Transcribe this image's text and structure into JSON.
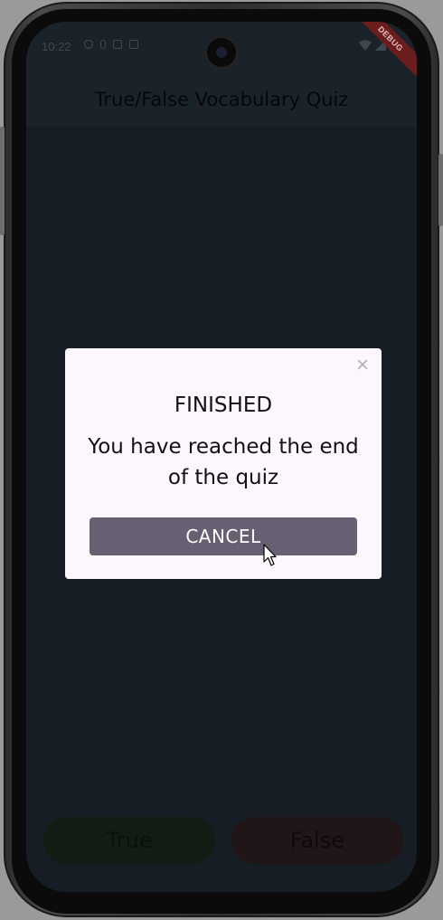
{
  "status_bar": {
    "time": "10:22"
  },
  "debug_ribbon": "DEBUG",
  "app_bar": {
    "title": "True/False Vocabulary Quiz"
  },
  "answers": {
    "true_label": "True",
    "false_label": "False"
  },
  "dialog": {
    "title": "FINISHED",
    "message": "You have reached the end of the quiz",
    "cancel_label": "CANCEL",
    "close_symbol": "×"
  },
  "colors": {
    "screen_bg": "#161d24",
    "dialog_bg": "#fdf7fd",
    "cancel_button": "#675f72",
    "debug_ribbon": "#6b1d1d"
  }
}
